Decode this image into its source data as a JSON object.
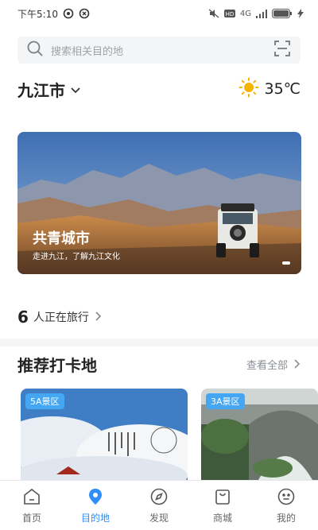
{
  "status_bar": {
    "time": "下午5:10",
    "network": "4G",
    "battery": "100"
  },
  "search": {
    "placeholder": "搜索相关目的地"
  },
  "location": {
    "city": "九江市",
    "temperature": "35℃"
  },
  "banner": {
    "title": "共青城市",
    "subtitle": "走进九江，了解九江文化"
  },
  "travelers": {
    "count": "6",
    "text": "人正在旅行"
  },
  "checkin": {
    "title": "推荐打卡地",
    "see_all": "查看全部",
    "cards": [
      {
        "badge": "5A景区"
      },
      {
        "badge": "3A景区"
      }
    ]
  },
  "tabs": [
    {
      "label": "首页",
      "icon": "home-icon"
    },
    {
      "label": "目的地",
      "icon": "location-pin-icon",
      "active": true
    },
    {
      "label": "发现",
      "icon": "compass-icon"
    },
    {
      "label": "商城",
      "icon": "shop-icon"
    },
    {
      "label": "我的",
      "icon": "profile-icon"
    }
  ],
  "colors": {
    "accent": "#2f8ef7",
    "badge": "#45a7f3",
    "sun": "#f5b400"
  }
}
